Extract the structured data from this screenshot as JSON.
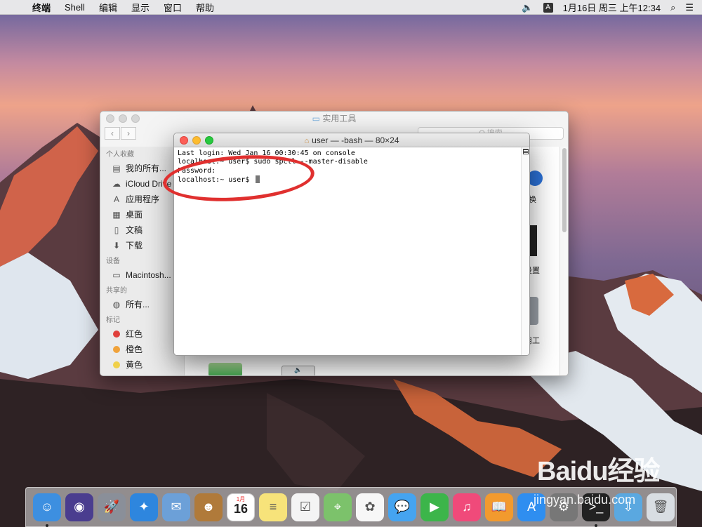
{
  "menubar": {
    "apple": "",
    "items": [
      "终端",
      "Shell",
      "编辑",
      "显示",
      "窗口",
      "帮助"
    ],
    "volume_icon": "volume-icon",
    "input_method": "A",
    "datetime": "1月16日 周三 上午12:34"
  },
  "finder": {
    "title": "实用工具",
    "search_placeholder": "Q 搜索",
    "sidebar": {
      "favorites_header": "个人收藏",
      "favorites": [
        "我的所有...",
        "iCloud Drive",
        "应用程序",
        "桌面",
        "文稿",
        "下载"
      ],
      "devices_header": "设备",
      "devices": [
        "Macintosh..."
      ],
      "shared_header": "共享的",
      "shared": [
        "所有..."
      ],
      "tags_header": "标记",
      "tags": [
        {
          "label": "红色",
          "color": "#e0403c"
        },
        {
          "label": "橙色",
          "color": "#f0a23a"
        },
        {
          "label": "黄色",
          "color": "#f0d04a"
        }
      ]
    },
    "partial_labels": [
      "换",
      "设置",
      "用工"
    ]
  },
  "terminal": {
    "title": "user — -bash — 80×24",
    "lines": [
      "Last login: Wed Jan 16 00:30:45 on console",
      "localhost:~ user$ sudo spctl --master-disable",
      "Password:",
      "localhost:~ user$ "
    ]
  },
  "dock": {
    "apps": [
      {
        "name": "finder",
        "color": "#3d8fe0",
        "glyph": "☺"
      },
      {
        "name": "siri",
        "color": "#4a3d8f",
        "glyph": "◉"
      },
      {
        "name": "launchpad",
        "color": "#8a8f99",
        "glyph": "🚀"
      },
      {
        "name": "safari",
        "color": "#2e86de",
        "glyph": "✦"
      },
      {
        "name": "mail",
        "color": "#6ca0d8",
        "glyph": "✉"
      },
      {
        "name": "contacts",
        "color": "#b07a3a",
        "glyph": "☻"
      },
      {
        "name": "calendar",
        "color": "#ffffff",
        "glyph": ""
      },
      {
        "name": "notes",
        "color": "#f7e37a",
        "glyph": "≡"
      },
      {
        "name": "reminders",
        "color": "#f4f4f4",
        "glyph": "☑"
      },
      {
        "name": "maps",
        "color": "#7cc26b",
        "glyph": "⌖"
      },
      {
        "name": "photos",
        "color": "#f7f7f7",
        "glyph": "✿"
      },
      {
        "name": "messages",
        "color": "#45a4f0",
        "glyph": "💬"
      },
      {
        "name": "facetime",
        "color": "#3cb54a",
        "glyph": "▶"
      },
      {
        "name": "itunes",
        "color": "#f04a7a",
        "glyph": "♫"
      },
      {
        "name": "ibooks",
        "color": "#f29a2e",
        "glyph": "📖"
      },
      {
        "name": "app-store",
        "color": "#2f8ef0",
        "glyph": "A"
      },
      {
        "name": "system-preferences",
        "color": "#777777",
        "glyph": "⚙"
      },
      {
        "name": "terminal",
        "color": "#222222",
        "glyph": ">_"
      },
      {
        "name": "downloads",
        "color": "#5aa8e0",
        "glyph": "⇩"
      },
      {
        "name": "trash",
        "color": "#d8dde2",
        "glyph": "🗑"
      }
    ],
    "calendar_month": "1月",
    "calendar_day": "16"
  },
  "watermark": {
    "logo": "Baidu经验",
    "url": "jingyan.baidu.com"
  }
}
